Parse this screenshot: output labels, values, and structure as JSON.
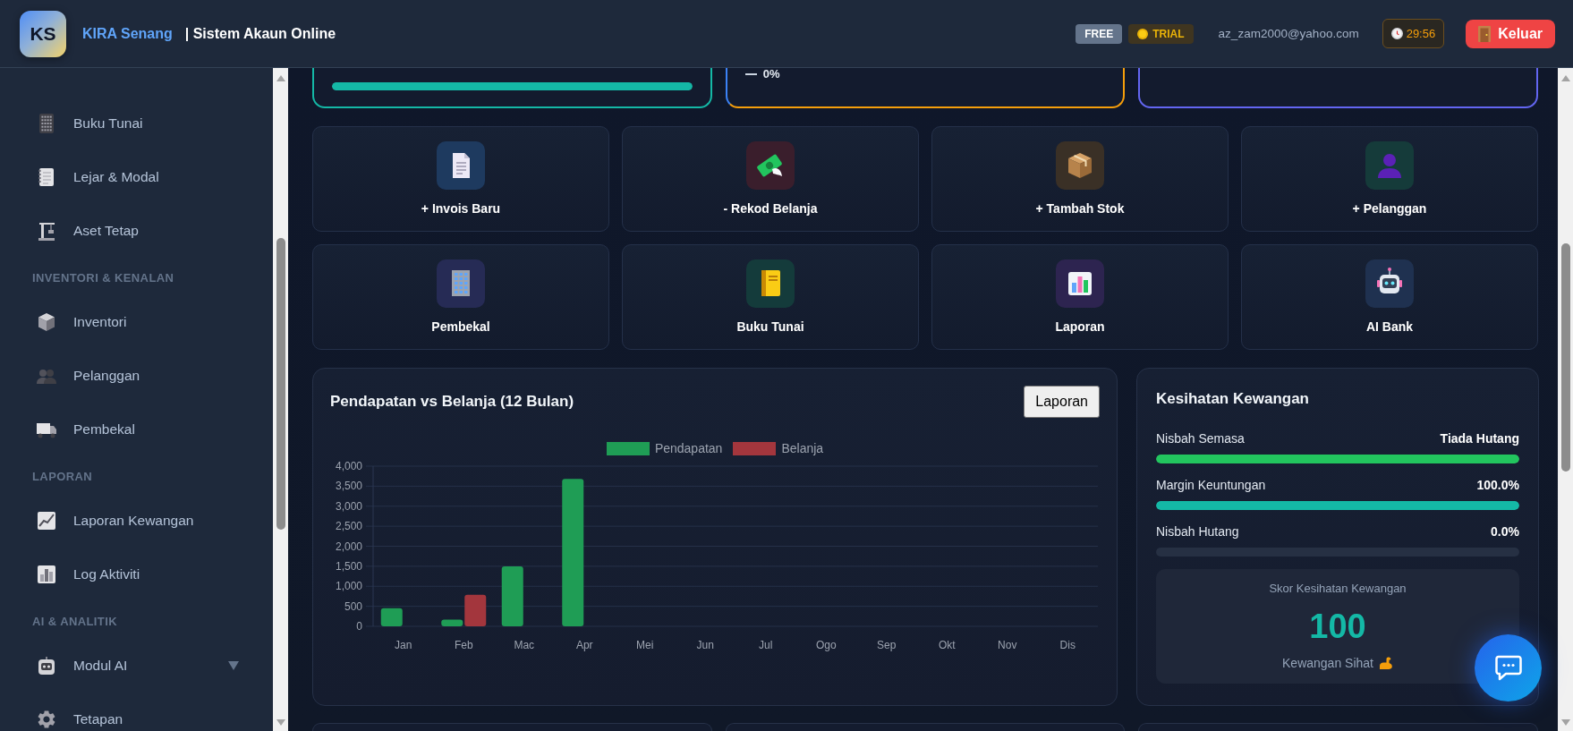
{
  "header": {
    "logo": "KS",
    "brand": "KIRA Senang",
    "subtitle": "| Sistem Akaun Online",
    "badges": [
      {
        "kind": "plan",
        "label": "FREE"
      },
      {
        "kind": "trial",
        "label": "TRIAL"
      }
    ],
    "email": "az_zam2000@yahoo.com",
    "timer": "29:56",
    "logout": "Keluar"
  },
  "sidebar": {
    "groups": [
      {
        "items": [
          {
            "kind": "link",
            "label": "Buku Tunai",
            "selected": false
          },
          {
            "kind": "link",
            "label": "Lejar & Modal",
            "selected": false
          },
          {
            "kind": "link",
            "label": "Aset Tetap",
            "selected": false
          }
        ]
      },
      {
        "title": "INVENTORI & KENALAN",
        "items": [
          {
            "kind": "link",
            "label": "Inventori",
            "selected": false
          },
          {
            "kind": "link",
            "label": "Pelanggan",
            "selected": false
          },
          {
            "kind": "link",
            "label": "Pembekal",
            "selected": false
          }
        ]
      },
      {
        "title": "LAPORAN",
        "items": [
          {
            "kind": "link",
            "label": "Laporan Kewangan",
            "selected": false
          },
          {
            "kind": "link",
            "label": "Log Aktiviti",
            "selected": false
          }
        ]
      },
      {
        "title": "AI & ANALITIK",
        "items": [
          {
            "kind": "menu",
            "label": "Modul AI",
            "selected": false,
            "expanded": false
          },
          {
            "kind": "link",
            "label": "Tetapan",
            "selected": false
          }
        ]
      }
    ]
  },
  "summary_cards": [
    {
      "kind": "progress",
      "level": 1
    },
    {
      "kind": "trend",
      "value": "0%"
    },
    {
      "kind": "blank"
    }
  ],
  "quick_actions": [
    {
      "label": "+ Invois Baru"
    },
    {
      "label": "- Rekod Belanja"
    },
    {
      "label": "+ Tambah Stok"
    },
    {
      "label": "+ Pelanggan"
    },
    {
      "label": "Pembekal"
    },
    {
      "label": "Buku Tunai"
    },
    {
      "label": "Laporan"
    },
    {
      "label": "AI Bank"
    }
  ],
  "chart_card": {
    "button": "Laporan",
    "chart_data": {
      "type": "bar",
      "title": "Pendapatan vs Belanja (12 Bulan)",
      "legend": "top",
      "grid": true,
      "categories": [
        "Jan",
        "Feb",
        "Mac",
        "Apr",
        "Mei",
        "Jun",
        "Jul",
        "Ogo",
        "Sep",
        "Okt",
        "Nov",
        "Dis"
      ],
      "series": [
        {
          "name": "Pendapatan",
          "color": "#1f9d55",
          "values": [
            450,
            170,
            1500,
            3680,
            0,
            0,
            0,
            0,
            0,
            0,
            0,
            0
          ]
        },
        {
          "name": "Belanja",
          "color": "#a3363d",
          "values": [
            0,
            790,
            0,
            0,
            0,
            0,
            0,
            0,
            0,
            0,
            0,
            0
          ]
        }
      ],
      "ylim": [
        0,
        4000
      ],
      "yticks": [
        {
          "value": 0,
          "label": "0"
        },
        {
          "value": 500,
          "label": "500"
        },
        {
          "value": 1000,
          "label": "1,000"
        },
        {
          "value": 1500,
          "label": "1,500"
        },
        {
          "value": 2000,
          "label": "2,000"
        },
        {
          "value": 2500,
          "label": "2,500"
        },
        {
          "value": 3000,
          "label": "3,000"
        },
        {
          "value": 3500,
          "label": "3,500"
        },
        {
          "value": 4000,
          "label": "4,000"
        }
      ]
    }
  },
  "health": {
    "title": "Kesihatan Kewangan",
    "metrics": [
      {
        "label": "Nisbah Semasa",
        "value": "Tiada Hutang",
        "level": 1,
        "color": "#22c55e"
      },
      {
        "label": "Margin Keuntungan",
        "value": "100.0%",
        "level": 1,
        "color": "#14b8a6"
      },
      {
        "label": "Nisbah Hutang",
        "value": "0.0%",
        "level": 0
      }
    ],
    "score": {
      "label": "Skor Kesihatan Kewangan",
      "value": "100",
      "caption": "Kewangan Sihat"
    }
  }
}
